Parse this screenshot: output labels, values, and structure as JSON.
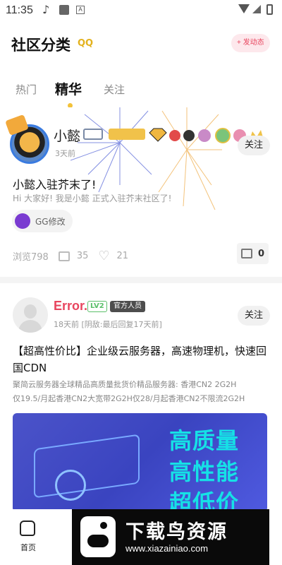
{
  "status_bar": {
    "time": "11:35",
    "icons": [
      "music-note-icon",
      "app-square-icon",
      "a-badge-icon",
      "wifi-icon",
      "signal-icon",
      "battery-icon"
    ]
  },
  "header": {
    "title": "社区分类",
    "title_deco": "QQ",
    "post_button": "+ 发动态"
  },
  "tabs": [
    {
      "label": "热门",
      "active": false
    },
    {
      "label": "精华",
      "active": true
    },
    {
      "label": "关注",
      "active": false
    }
  ],
  "posts": [
    {
      "author": "小懿",
      "time": "3天前",
      "follow": "关注",
      "title": "小懿入驻芥末了!",
      "body": "Hi 大家好! 我是小懿 正式入驻芥末社区了!",
      "chip": "GG修改",
      "views": "浏览798",
      "comments": "35",
      "likes": "21",
      "images": "0"
    },
    {
      "author": "Error.",
      "level": "LV2",
      "role": "官方人员",
      "time": "18天前 [阴敌:最后回复17天前]",
      "follow": "关注",
      "title": "【超高性价比】企业级云服务器，高速物理机，快速回国CDN",
      "body_line1": "聚简云服务器全球精品高质量批货价精品服务器: 香港CN2 2G2H",
      "body_line2": "仅19.5/月起香港CN2大宽带2G2H仅28/月起香港CN2不限流2G2H",
      "banner_lines": [
        "高质量",
        "高性能",
        "超低价"
      ]
    }
  ],
  "bottom_nav": {
    "home": "首页"
  },
  "watermark": {
    "title": "下载鸟资源",
    "url": "www.xiazainiao.com"
  },
  "colors": {
    "accent": "#e8455e",
    "banner": "#3a44c0",
    "banner_text": "#16e1e6",
    "tab_dot": "#f3c23a"
  }
}
